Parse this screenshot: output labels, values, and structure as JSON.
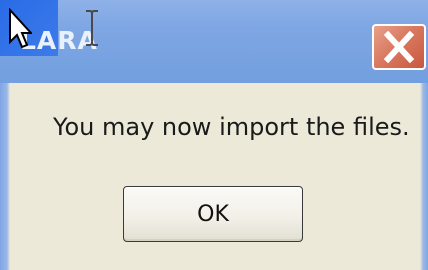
{
  "window": {
    "title": "LARA",
    "close_icon": "close-x-icon"
  },
  "message": {
    "text": "You may now import the files."
  },
  "buttons": {
    "ok_label": "OK"
  },
  "cursors": {
    "pointer": "arrow-cursor-icon",
    "text": "ibeam-cursor-icon"
  },
  "colors": {
    "titlebar": "#7ea6e3",
    "close_button": "#d97a60",
    "dialog_background": "#ece9d8"
  }
}
